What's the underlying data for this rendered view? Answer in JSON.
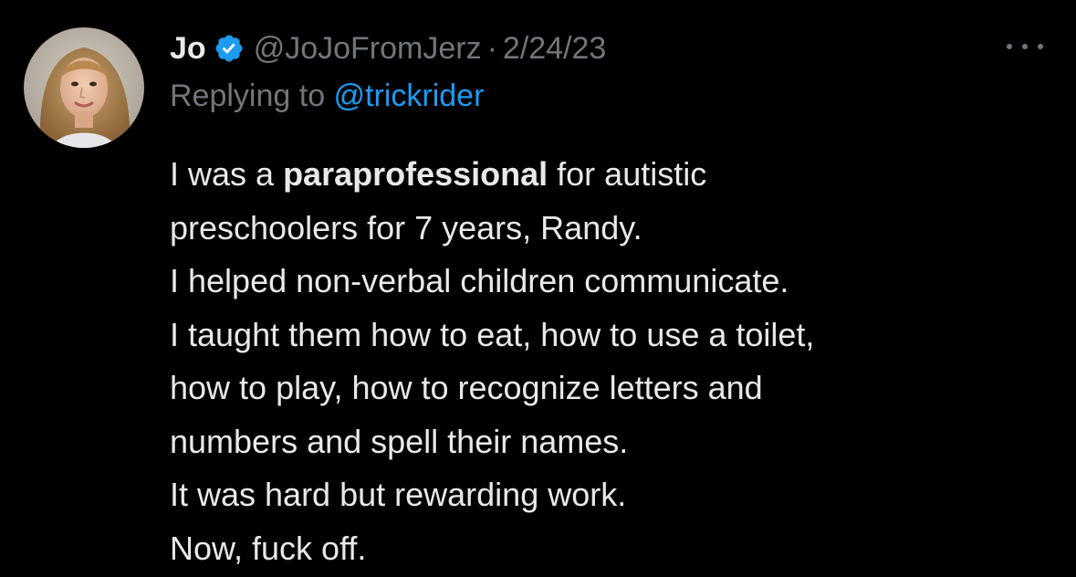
{
  "tweet": {
    "author": {
      "name": "Jo",
      "handle": "@JoJoFromJerz",
      "verified_icon": "verified-badge-icon",
      "verified_color": "#1d9bf0"
    },
    "separator": "·",
    "date": "2/24/23",
    "more_icon": "more-options-icon",
    "reply": {
      "prefix": "Replying to ",
      "mention": "@trickrider"
    },
    "text": {
      "l1_pre": "I was a ",
      "l1_bold": "paraprofessional",
      "l1_post": " for autistic",
      "l2": "preschoolers for 7 years, Randy.",
      "l3": "I helped non-verbal children communicate.",
      "l4": "I taught them how to eat, how to use a toilet,",
      "l5": "how to play, how to recognize letters and",
      "l6": "numbers and spell their names.",
      "l7": "It was hard but rewarding work.",
      "l8": "Now, fuck off."
    }
  },
  "colors": {
    "background": "#000000",
    "primary_text": "#e7e9ea",
    "secondary_text": "#71767b",
    "accent": "#1d9bf0"
  }
}
